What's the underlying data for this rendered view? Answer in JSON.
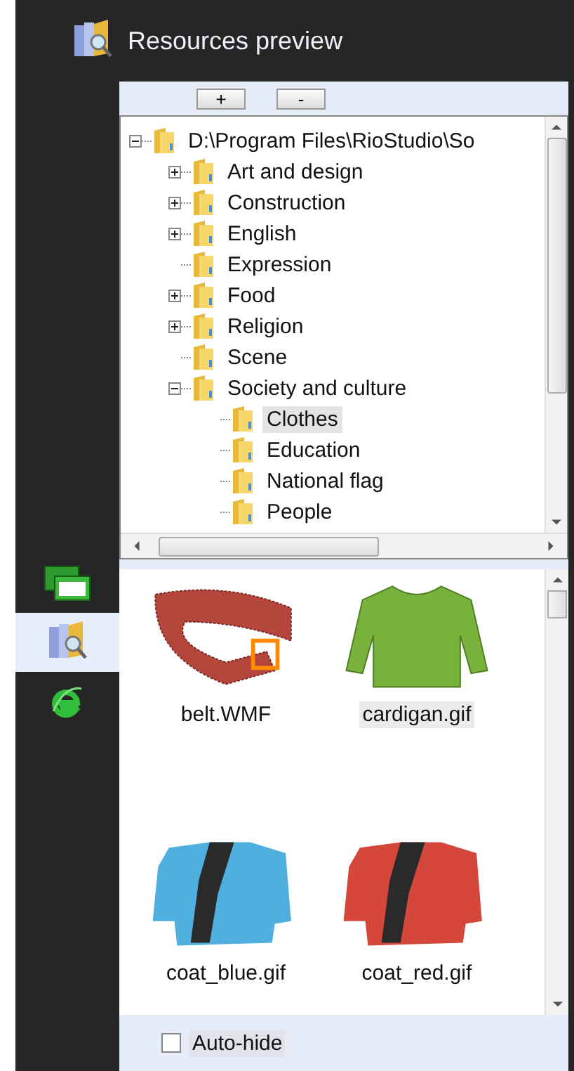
{
  "header": {
    "title": "Resources preview"
  },
  "sidebar": {
    "items": [
      {
        "kind": "windows",
        "selected": false
      },
      {
        "kind": "preview",
        "selected": true
      },
      {
        "kind": "browser",
        "selected": false
      }
    ]
  },
  "toolbar": {
    "buttons": [
      "+",
      "-"
    ]
  },
  "tree": {
    "nodes": [
      {
        "label": "D:\\Program Files\\RioStudio\\So",
        "expanded": true,
        "selected": false,
        "children": [
          {
            "label": "Art and design",
            "expanded": false,
            "selected": false
          },
          {
            "label": "Construction",
            "expanded": false,
            "selected": false
          },
          {
            "label": "English",
            "expanded": false,
            "selected": false
          },
          {
            "label": "Expression",
            "selected": false
          },
          {
            "label": "Food",
            "expanded": false,
            "selected": false
          },
          {
            "label": "Religion",
            "expanded": false,
            "selected": false
          },
          {
            "label": "Scene",
            "selected": false
          },
          {
            "label": "Society and culture",
            "expanded": true,
            "selected": false,
            "children": [
              {
                "label": "Clothes",
                "selected": true
              },
              {
                "label": "Education",
                "selected": false
              },
              {
                "label": "National flag",
                "selected": false
              },
              {
                "label": "People",
                "selected": false
              }
            ]
          }
        ]
      }
    ]
  },
  "gallery": {
    "items": [
      {
        "name": "belt.WMF",
        "kind": "belt",
        "color": "#b5463c",
        "selected": false
      },
      {
        "name": "cardigan.gif",
        "kind": "cardigan",
        "color": "#78b13c",
        "selected": true
      },
      {
        "name": "coat_blue.gif",
        "kind": "coat",
        "color": "#4fb0e0",
        "selected": false
      },
      {
        "name": "coat_red.gif",
        "kind": "coat",
        "color": "#d4473a",
        "selected": false
      }
    ]
  },
  "auto_hide": {
    "label": "Auto-hide",
    "checked": false
  }
}
